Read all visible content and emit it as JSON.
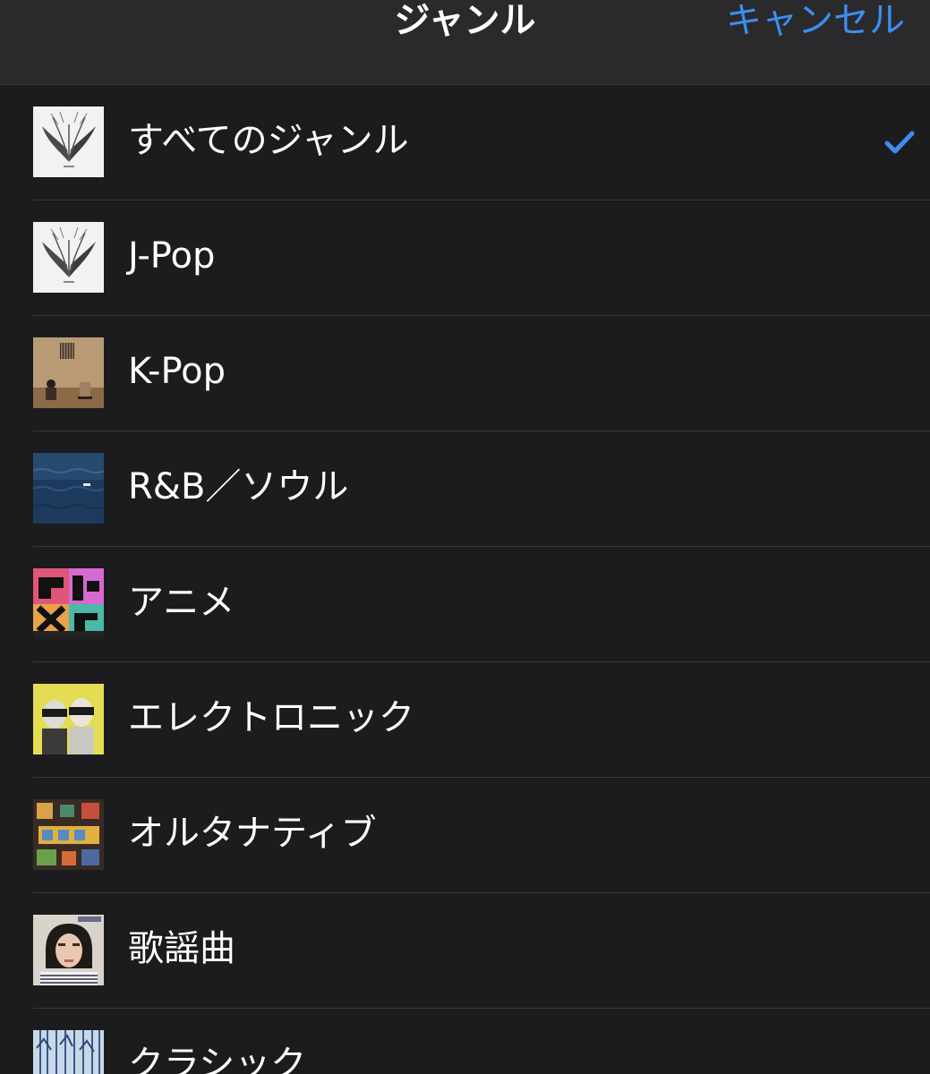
{
  "navbar": {
    "title": "ジャンル",
    "cancel_label": "キャンセル"
  },
  "genres": [
    {
      "label": "すべてのジャンル",
      "selected": true,
      "artwork": "white-feather-artwork"
    },
    {
      "label": "J-Pop",
      "selected": false,
      "artwork": "white-feather-artwork"
    },
    {
      "label": "K-Pop",
      "selected": false,
      "artwork": "brown-room-artwork"
    },
    {
      "label": "R&B／ソウル",
      "selected": false,
      "artwork": "ocean-artwork"
    },
    {
      "label": "アニメ",
      "selected": false,
      "artwork": "colorful-graphic-artwork"
    },
    {
      "label": "エレクトロニック",
      "selected": false,
      "artwork": "yellow-duo-artwork"
    },
    {
      "label": "オルタナティブ",
      "selected": false,
      "artwork": "busy-illustration-artwork"
    },
    {
      "label": "歌謡曲",
      "selected": false,
      "artwork": "portrait-artwork"
    },
    {
      "label": "クラシック",
      "selected": false,
      "artwork": "blue-trees-artwork"
    }
  ],
  "colors": {
    "accent": "#3d8ef0",
    "background": "#1c1c1e",
    "navbar": "#2a2a2c",
    "separator": "#38383a"
  }
}
